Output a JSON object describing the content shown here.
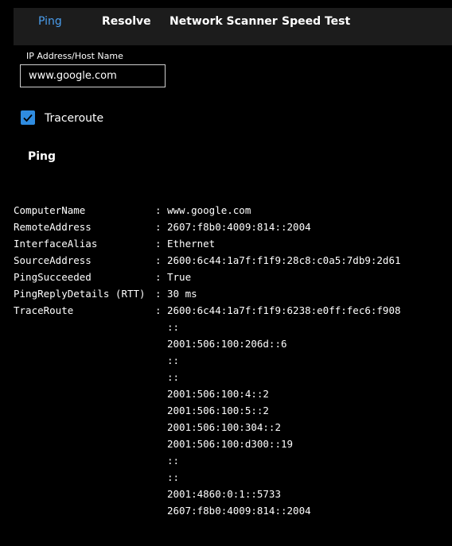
{
  "tabs": [
    {
      "label": "Ping",
      "active": true
    },
    {
      "label": "Resolve"
    },
    {
      "label": "Network Scanner"
    },
    {
      "label": "Speed Test"
    }
  ],
  "host_field": {
    "label": "IP Address/Host Name",
    "value": "www.google.com"
  },
  "traceroute": {
    "label": "Traceroute",
    "checked": true
  },
  "section_title": "Ping",
  "accent_color": "#4a9ded",
  "checkbox_color": "#2f8ce0",
  "output": {
    "separator": ":",
    "rows": [
      {
        "key": "ComputerName",
        "value": "www.google.com"
      },
      {
        "key": "RemoteAddress",
        "value": "2607:f8b0:4009:814::2004"
      },
      {
        "key": "InterfaceAlias",
        "value": "Ethernet"
      },
      {
        "key": "SourceAddress",
        "value": "2600:6c44:1a7f:f1f9:28c8:c0a5:7db9:2d61"
      },
      {
        "key": "PingSucceeded",
        "value": "True"
      },
      {
        "key": "PingReplyDetails (RTT)",
        "value": "30 ms"
      },
      {
        "key": "TraceRoute",
        "value": "2600:6c44:1a7f:f1f9:6238:e0ff:fec6:f908"
      }
    ],
    "trace_continuation": [
      "::",
      "2001:506:100:206d::6",
      "::",
      "::",
      "2001:506:100:4::2",
      "2001:506:100:5::2",
      "2001:506:100:304::2",
      "2001:506:100:d300::19",
      "::",
      "::",
      "2001:4860:0:1::5733",
      "2607:f8b0:4009:814::2004"
    ]
  }
}
